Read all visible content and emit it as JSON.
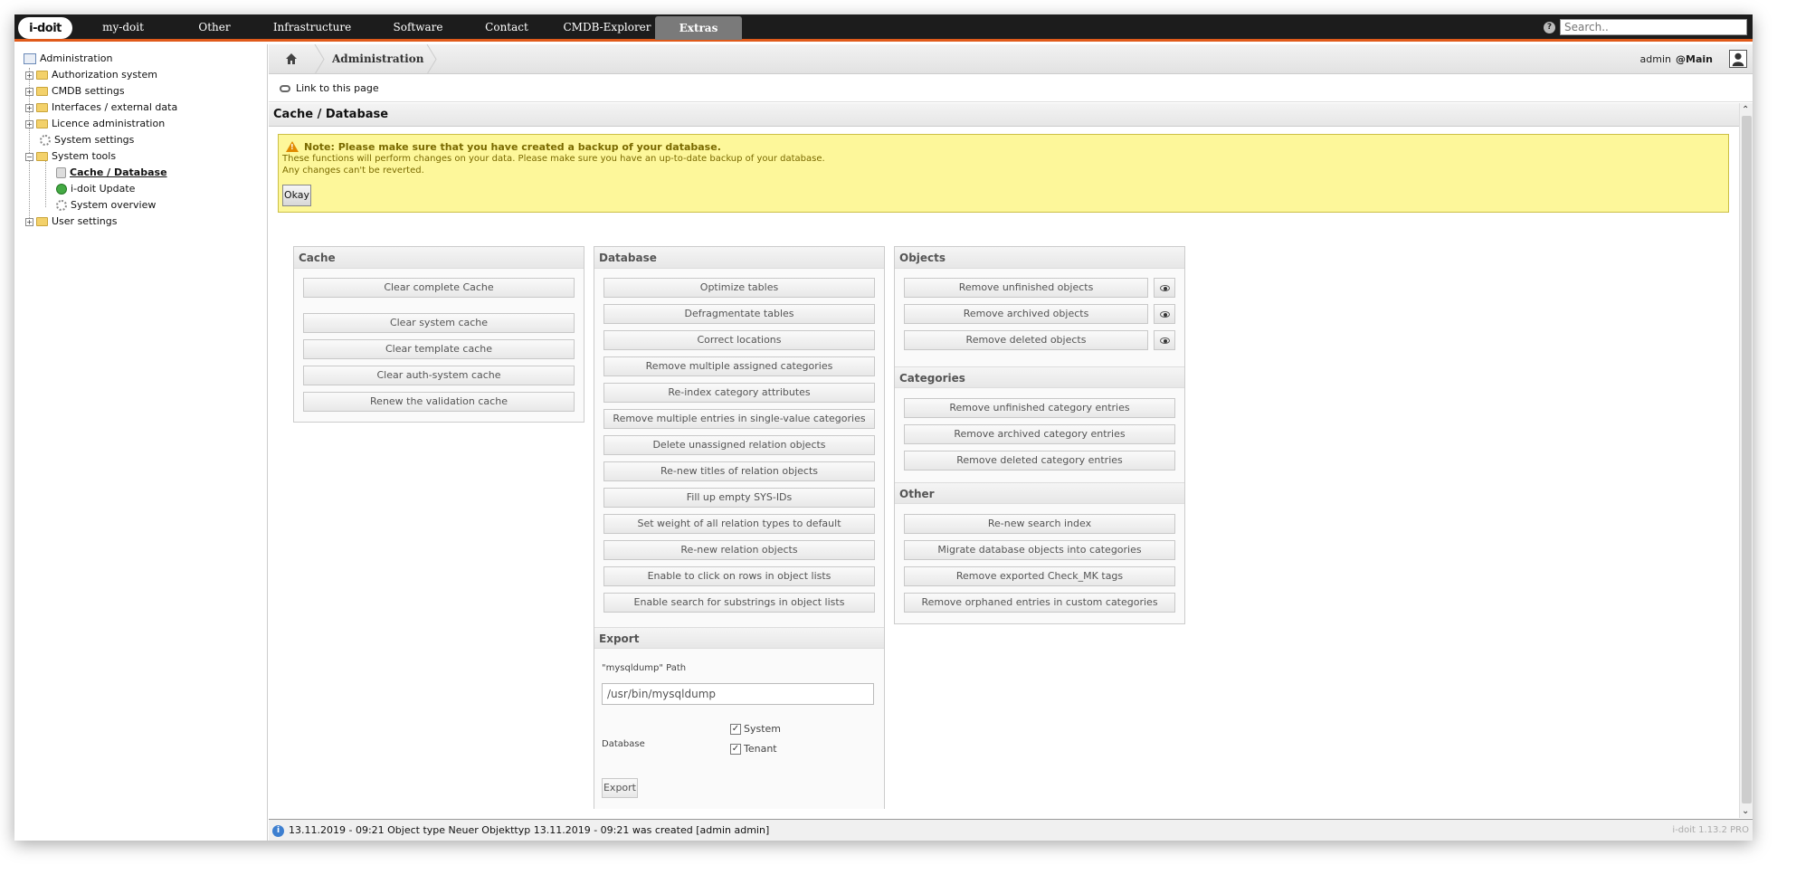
{
  "nav": {
    "logo": "i-doit",
    "items": [
      "my-doit",
      "Other",
      "Infrastructure",
      "Software",
      "Contact",
      "CMDB-Explorer",
      "Extras"
    ],
    "active": "Extras",
    "search_placeholder": "Search.."
  },
  "sidebar": {
    "root": "Administration",
    "items": {
      "authorization": "Authorization system",
      "cmdb": "CMDB settings",
      "interfaces": "Interfaces / external data",
      "licence": "Licence administration",
      "system_settings": "System settings",
      "system_tools": "System tools",
      "cache_db": "Cache / Database",
      "update": "i-doit Update",
      "overview": "System overview",
      "user_settings": "User settings"
    }
  },
  "breadcrumb": {
    "current": "Administration",
    "user": "admin",
    "tenant": "@Main"
  },
  "link_text": "Link to this page",
  "page_title": "Cache / Database",
  "note": {
    "title": "Note: Please make sure that you have created a backup of your database.",
    "line1": "These functions will perform changes on your data. Please make sure you have an up-to-date backup of your database.",
    "line2": "Any changes can't be reverted.",
    "button": "Okay"
  },
  "cache": {
    "title": "Cache",
    "buttons": [
      "Clear complete Cache",
      "Clear system cache",
      "Clear template cache",
      "Clear auth-system cache",
      "Renew the validation cache"
    ]
  },
  "database": {
    "title": "Database",
    "buttons": [
      "Optimize tables",
      "Defragmentate tables",
      "Correct locations",
      "Remove multiple assigned categories",
      "Re-index category attributes",
      "Remove multiple entries in single-value categories",
      "Delete unassigned relation objects",
      "Re-new titles of relation objects",
      "Fill up empty SYS-IDs",
      "Set weight of all relation types to default",
      "Re-new relation objects",
      "Enable to click on rows in object lists",
      "Enable search for substrings in object lists"
    ]
  },
  "export": {
    "title": "Export",
    "path_label": "\"mysqldump\" Path",
    "path_value": "/usr/bin/mysqldump",
    "db_label": "Database",
    "checks": [
      "System",
      "Tenant"
    ],
    "button": "Export"
  },
  "objects": {
    "title": "Objects",
    "buttons": [
      "Remove unfinished objects",
      "Remove archived objects",
      "Remove deleted objects"
    ]
  },
  "categories": {
    "title": "Categories",
    "buttons": [
      "Remove unfinished category entries",
      "Remove archived category entries",
      "Remove deleted category entries"
    ]
  },
  "other": {
    "title": "Other",
    "buttons": [
      "Re-new search index",
      "Migrate database objects into categories",
      "Remove exported Check_MK tags",
      "Remove orphaned entries in custom categories"
    ]
  },
  "status": {
    "message": "13.11.2019 - 09:21 Object type Neuer Objekttyp 13.11.2019 - 09:21 was created [admin admin]",
    "version": "i-doit 1.13.2 PRO"
  },
  "colors": {
    "accent": "#e05a1a",
    "note_bg": "#fdf79a",
    "topbar": "#1c1c1c"
  }
}
